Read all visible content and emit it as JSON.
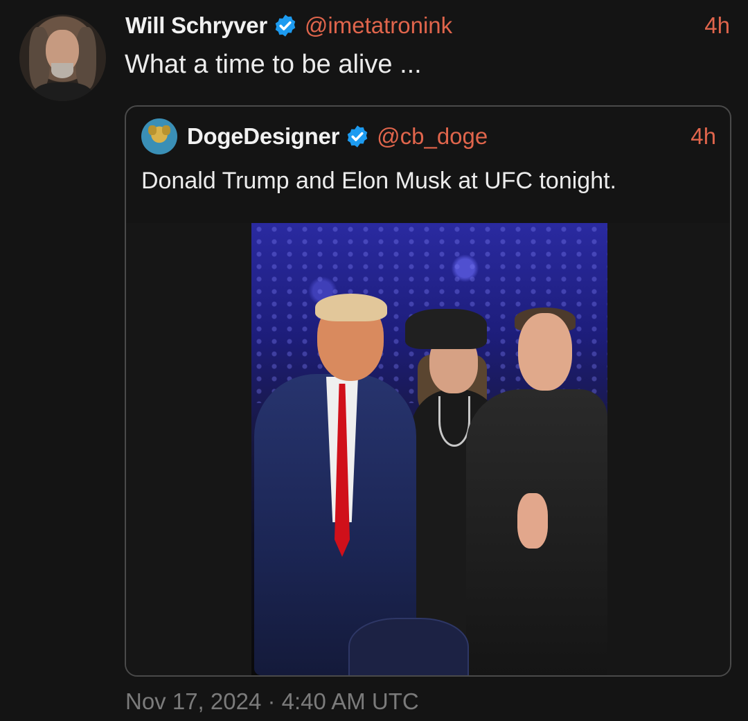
{
  "tweet": {
    "author_name": "Will Schryver",
    "author_handle": "@imetatronink",
    "time_ago": "4h",
    "text": "What a time to be alive ...",
    "timestamp": "Nov 17, 2024 · 4:40 AM UTC"
  },
  "quoted_tweet": {
    "author_name": "DogeDesigner",
    "author_handle": "@cb_doge",
    "time_ago": "4h",
    "text": "Donald Trump and Elon Musk at UFC tonight."
  },
  "icons": {
    "verified": "verified-badge-icon"
  },
  "colors": {
    "background": "#141414",
    "accent": "#e0654c",
    "verified": "#1d9bf0",
    "muted": "#7b7b7b"
  }
}
